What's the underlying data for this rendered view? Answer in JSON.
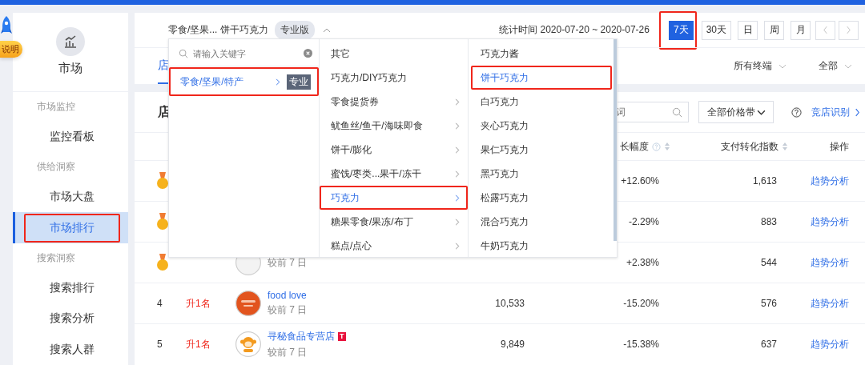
{
  "rail": {
    "badge": "说明"
  },
  "sidebar": {
    "title": "市场",
    "groups": [
      {
        "label": "市场监控",
        "items": [
          {
            "label": "监控看板",
            "selected": false,
            "annotated": false
          }
        ]
      },
      {
        "label": "供给洞察",
        "items": [
          {
            "label": "市场大盘",
            "selected": false,
            "annotated": false
          },
          {
            "label": "市场排行",
            "selected": true,
            "annotated": true
          }
        ]
      },
      {
        "label": "搜索洞察",
        "items": [
          {
            "label": "搜索排行",
            "selected": false,
            "annotated": false
          },
          {
            "label": "搜索分析",
            "selected": false,
            "annotated": false
          },
          {
            "label": "搜索人群",
            "selected": false,
            "annotated": false
          }
        ]
      }
    ]
  },
  "header": {
    "breadcrumb": "零食/坚果... 饼干巧克力",
    "edition": "专业版",
    "stat_time": "统计时间 2020-07-20 ~ 2020-07-26",
    "periods": [
      {
        "label": "7天",
        "selected": true,
        "annotated": true
      },
      {
        "label": "30天",
        "selected": false,
        "annotated": false
      },
      {
        "label": "日",
        "selected": false,
        "annotated": false
      },
      {
        "label": "周",
        "selected": false,
        "annotated": false
      },
      {
        "label": "月",
        "selected": false,
        "annotated": false
      }
    ]
  },
  "tabs": [
    {
      "label": "店",
      "selected": true
    }
  ],
  "filters": [
    "所有终端",
    "全部"
  ],
  "panel": {
    "title": "店",
    "search": {
      "placeholder": "词"
    },
    "price_filter": "全部价格带",
    "link": "竞店识别"
  },
  "table": {
    "columns": [
      {
        "label": "长幅度",
        "help": true,
        "sortable": true
      },
      {
        "label": "支付转化指数",
        "help": false,
        "sortable": true
      },
      {
        "label": "操作",
        "help": false,
        "sortable": false
      }
    ],
    "rows": [
      {
        "medal": true,
        "growth": "+12.60%",
        "conversion": "1,613",
        "action": "趋势分析"
      },
      {
        "medal": true,
        "growth": "-2.29%",
        "conversion": "883",
        "action": "趋势分析"
      },
      {
        "medal": true,
        "logo": {
          "kind": "plain"
        },
        "compare": "较前 7 日",
        "growth": "+2.38%",
        "conversion": "544",
        "action": "趋势分析"
      },
      {
        "medal": false,
        "rank": "4",
        "change": "升1名",
        "logo": {
          "kind": "orange"
        },
        "shop": "food love",
        "compare": "较前 7 日",
        "value": "10,533",
        "growth": "-15.20%",
        "conversion": "576",
        "action": "趋势分析"
      },
      {
        "medal": false,
        "rank": "5",
        "change": "升1名",
        "logo": {
          "kind": "monkey"
        },
        "shop": "寻秘食品专营店",
        "tag": "T",
        "compare": "较前 7 日",
        "value": "9,849",
        "growth": "-15.38%",
        "conversion": "637",
        "action": "趋势分析"
      }
    ]
  },
  "dropdown": {
    "search": {
      "placeholder": "请输入关键字"
    },
    "level1": [
      {
        "label": "零食/坚果/特产",
        "tag": "专业",
        "has_children": true,
        "selected": true,
        "annotated": true
      }
    ],
    "level2": [
      {
        "label": "其它",
        "has_children": false,
        "selected": false,
        "annotated": false
      },
      {
        "label": "巧克力/DIY巧克力",
        "has_children": false,
        "selected": false,
        "annotated": false
      },
      {
        "label": "零食提货券",
        "has_children": true,
        "selected": false,
        "annotated": false
      },
      {
        "label": "鱿鱼丝/鱼干/海味即食",
        "has_children": true,
        "selected": false,
        "annotated": false
      },
      {
        "label": "饼干/膨化",
        "has_children": true,
        "selected": false,
        "annotated": false
      },
      {
        "label": "蜜饯/枣类...果干/冻干",
        "has_children": true,
        "selected": false,
        "annotated": false
      },
      {
        "label": "巧克力",
        "has_children": true,
        "selected": true,
        "annotated": true
      },
      {
        "label": "糖果零食/果冻/布丁",
        "has_children": true,
        "selected": false,
        "annotated": false
      },
      {
        "label": "糕点/点心",
        "has_children": true,
        "selected": false,
        "annotated": false
      }
    ],
    "level3": [
      {
        "label": "巧克力酱",
        "selected": false,
        "annotated": false
      },
      {
        "label": "饼干巧克力",
        "selected": true,
        "annotated": true
      },
      {
        "label": "白巧克力",
        "selected": false,
        "annotated": false
      },
      {
        "label": "夹心巧克力",
        "selected": false,
        "annotated": false
      },
      {
        "label": "果仁巧克力",
        "selected": false,
        "annotated": false
      },
      {
        "label": "黑巧克力",
        "selected": false,
        "annotated": false
      },
      {
        "label": "松露巧克力",
        "selected": false,
        "annotated": false
      },
      {
        "label": "混合巧克力",
        "selected": false,
        "annotated": false
      },
      {
        "label": "牛奶巧克力",
        "selected": false,
        "annotated": false
      }
    ]
  }
}
